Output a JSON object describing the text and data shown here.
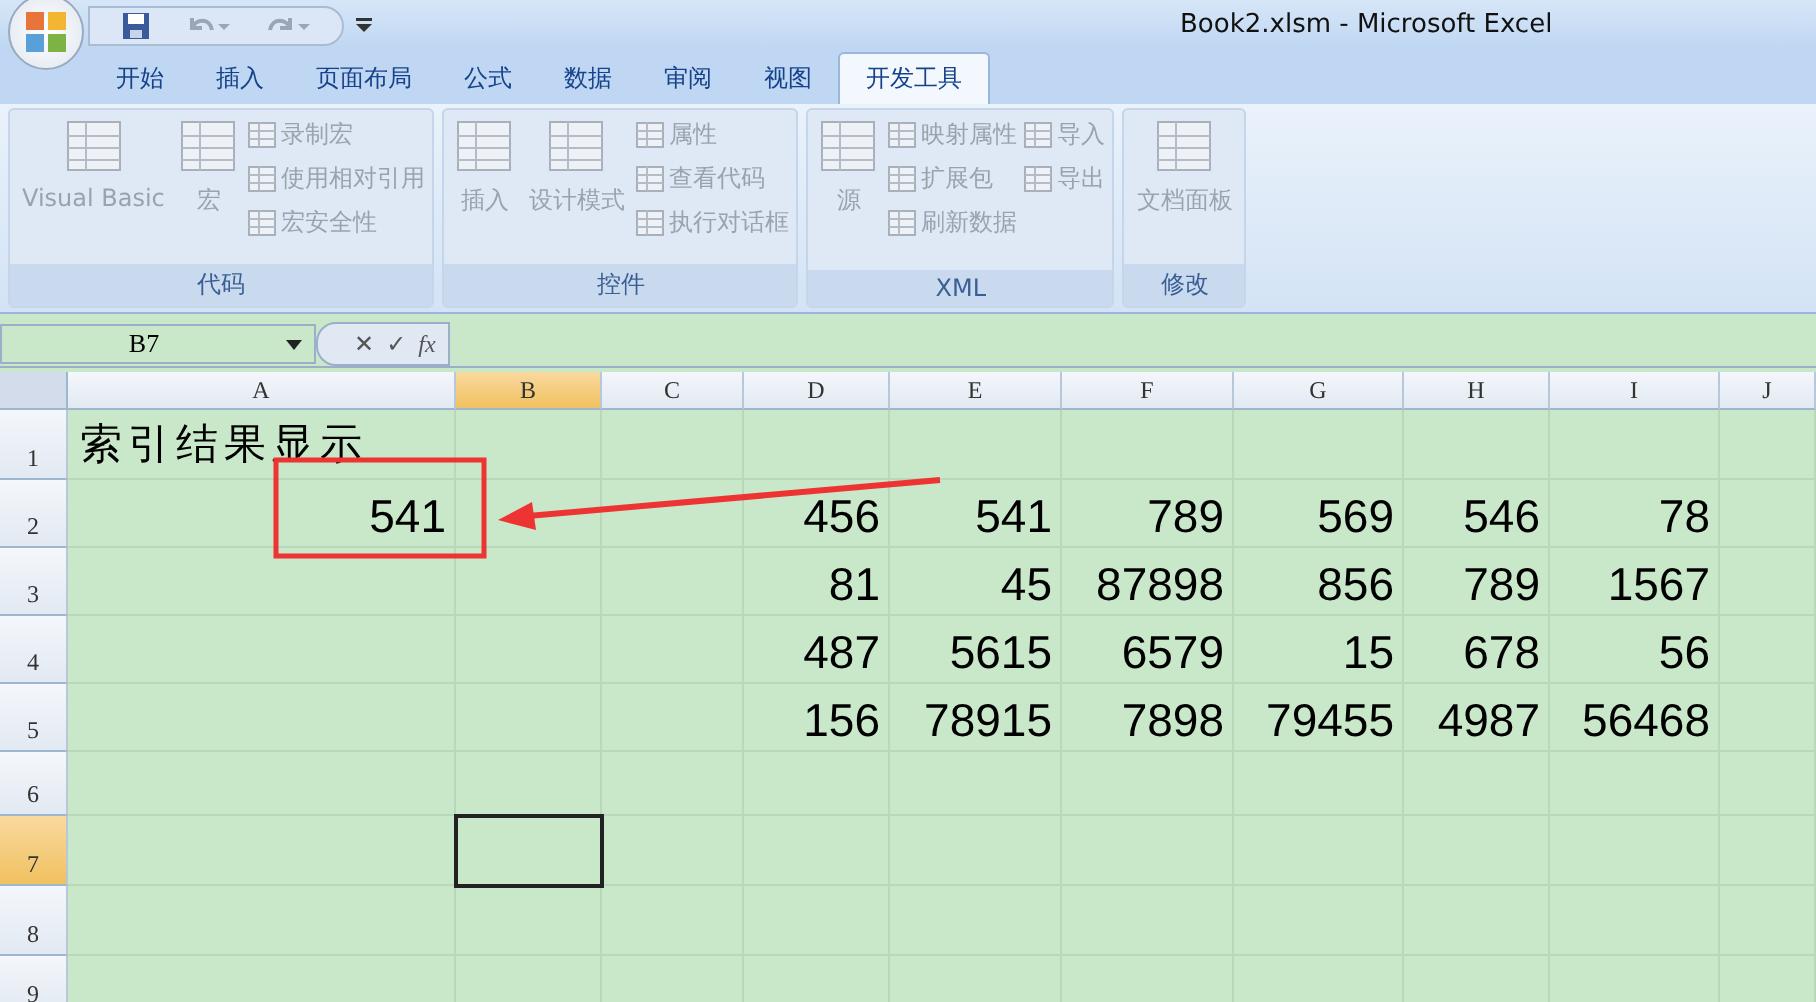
{
  "window": {
    "title": "Book2.xlsm  -  Microsoft Excel"
  },
  "tabs": [
    {
      "label": "开始",
      "selected": false
    },
    {
      "label": "插入",
      "selected": false
    },
    {
      "label": "页面布局",
      "selected": false
    },
    {
      "label": "公式",
      "selected": false
    },
    {
      "label": "数据",
      "selected": false
    },
    {
      "label": "审阅",
      "selected": false
    },
    {
      "label": "视图",
      "selected": false
    },
    {
      "label": "开发工具",
      "selected": true
    }
  ],
  "ribbon": {
    "groups": [
      {
        "label": "代码",
        "items": [
          {
            "label": "Visual Basic",
            "kind": "large",
            "disabled": true
          },
          {
            "label": "宏",
            "kind": "large",
            "disabled": true
          },
          {
            "label": "录制宏",
            "kind": "small",
            "disabled": true
          },
          {
            "label": "使用相对引用",
            "kind": "small",
            "disabled": true
          },
          {
            "label": "宏安全性",
            "kind": "small",
            "disabled": true
          }
        ]
      },
      {
        "label": "控件",
        "items": [
          {
            "label": "插入",
            "kind": "large",
            "disabled": true
          },
          {
            "label": "设计模式",
            "kind": "large",
            "disabled": true
          },
          {
            "label": "属性",
            "kind": "small",
            "disabled": true
          },
          {
            "label": "查看代码",
            "kind": "small",
            "disabled": true
          },
          {
            "label": "执行对话框",
            "kind": "small",
            "disabled": true
          }
        ]
      },
      {
        "label": "XML",
        "items": [
          {
            "label": "源",
            "kind": "large",
            "disabled": true
          },
          {
            "label": "映射属性",
            "kind": "small",
            "disabled": true
          },
          {
            "label": "扩展包",
            "kind": "small",
            "disabled": true
          },
          {
            "label": "刷新数据",
            "kind": "small",
            "disabled": true
          },
          {
            "label": "导入",
            "kind": "small",
            "disabled": true
          },
          {
            "label": "导出",
            "kind": "small",
            "disabled": true
          }
        ]
      },
      {
        "label": "修改",
        "items": [
          {
            "label": "文档面板",
            "kind": "large",
            "disabled": true
          }
        ]
      }
    ]
  },
  "formula_bar": {
    "name_box": "B7",
    "cancel": "✕",
    "enter": "✓",
    "function": "fx"
  },
  "columns": [
    {
      "label": "A",
      "selected": false
    },
    {
      "label": "B",
      "selected": true
    },
    {
      "label": "C",
      "selected": false
    },
    {
      "label": "D",
      "selected": false
    },
    {
      "label": "E",
      "selected": false
    },
    {
      "label": "F",
      "selected": false
    },
    {
      "label": "G",
      "selected": false
    },
    {
      "label": "H",
      "selected": false
    },
    {
      "label": "I",
      "selected": false
    },
    {
      "label": "J",
      "selected": false
    }
  ],
  "rows": [
    {
      "label": "1",
      "selected": false,
      "kind": "heading",
      "cells": [
        "索引结果显示",
        "",
        "",
        "",
        "",
        "",
        "",
        "",
        "",
        ""
      ]
    },
    {
      "label": "2",
      "selected": false,
      "cells": [
        "541",
        "",
        "",
        "456",
        "541",
        "789",
        "569",
        "546",
        "78",
        ""
      ]
    },
    {
      "label": "3",
      "selected": false,
      "cells": [
        "",
        "",
        "",
        "81",
        "45",
        "87898",
        "856",
        "789",
        "1567",
        ""
      ]
    },
    {
      "label": "4",
      "selected": false,
      "cells": [
        "",
        "",
        "",
        "487",
        "5615",
        "6579",
        "15",
        "678",
        "56",
        ""
      ]
    },
    {
      "label": "5",
      "selected": false,
      "cells": [
        "",
        "",
        "",
        "156",
        "78915",
        "7898",
        "79455",
        "4987",
        "56468",
        ""
      ]
    },
    {
      "label": "6",
      "selected": false,
      "cells": [
        "",
        "",
        "",
        "",
        "",
        "",
        "",
        "",
        "",
        ""
      ]
    },
    {
      "label": "7",
      "selected": true,
      "cells": [
        "",
        "",
        "",
        "",
        "",
        "",
        "",
        "",
        "",
        ""
      ]
    },
    {
      "label": "8",
      "selected": false,
      "cells": [
        "",
        "",
        "",
        "",
        "",
        "",
        "",
        "",
        "",
        ""
      ]
    },
    {
      "label": "9",
      "selected": false,
      "cells": [
        "",
        "",
        "",
        "",
        "",
        "",
        "",
        "",
        "",
        ""
      ]
    }
  ]
}
